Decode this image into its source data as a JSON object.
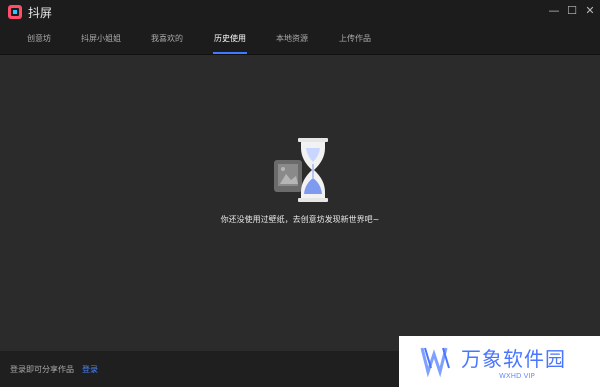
{
  "app": {
    "title": "抖屏"
  },
  "window_controls": {
    "minimize": "—",
    "maximize": "☐",
    "close": "✕"
  },
  "nav": {
    "tabs": [
      "创意坊",
      "抖屏小姐姐",
      "我喜欢的",
      "历史使用",
      "本地资源",
      "上传作品"
    ],
    "active": "历史使用"
  },
  "empty_state": {
    "message": "你还没使用过壁纸，去创意坊发现新世界吧~"
  },
  "footer": {
    "text": "登录即可分享作品",
    "login_label": "登录"
  },
  "watermark": {
    "brand": "万象软件园",
    "sub": "WXHD VIP"
  },
  "colors": {
    "accent": "#3e7bff",
    "background": "#2b2b2b",
    "bar": "#1c1c1c"
  }
}
